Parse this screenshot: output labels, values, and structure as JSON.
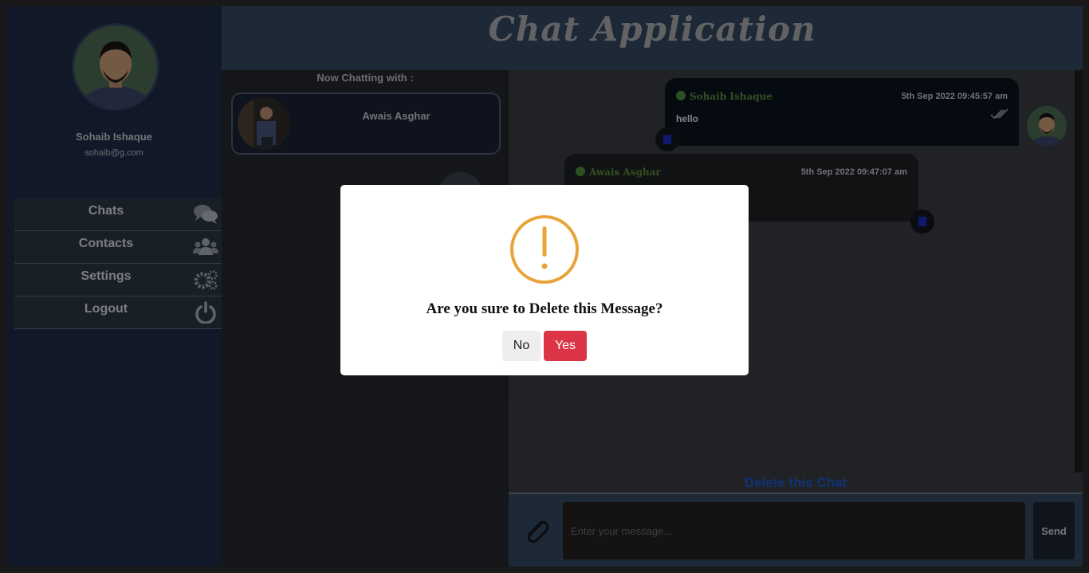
{
  "app": {
    "title": "Chat Application"
  },
  "user": {
    "name": "Sohaib Ishaque",
    "email": "sohaib@g.com"
  },
  "nav": [
    {
      "label": "Chats",
      "icon": "chats-icon"
    },
    {
      "label": "Contacts",
      "icon": "contacts-icon"
    },
    {
      "label": "Settings",
      "icon": "settings-icon"
    },
    {
      "label": "Logout",
      "icon": "power-icon"
    }
  ],
  "chat_list": {
    "heading": "Now Chatting with :",
    "active_contact": {
      "name": "Awais Asghar"
    }
  },
  "messages": [
    {
      "sender": "Sohaib Ishaque",
      "time": "5th Sep 2022 09:45:57 am",
      "text": "hello",
      "direction": "outgoing",
      "read": true
    },
    {
      "sender": "Awais Asghar",
      "time": "5th Sep 2022 09:47:07 am",
      "text": "",
      "direction": "incoming"
    }
  ],
  "actions": {
    "delete_chat": "Delete this Chat"
  },
  "composer": {
    "placeholder": "Enter your message...",
    "send_label": "Send"
  },
  "dialog": {
    "message": "Are you sure to Delete this Message?",
    "no_label": "No",
    "yes_label": "Yes",
    "icon": "warning-icon"
  },
  "colors": {
    "sidebar": "#1e2a44",
    "header": "#33475e",
    "danger": "#dc3545",
    "warning": "#e8a43a",
    "online": "#4c8a3a"
  }
}
